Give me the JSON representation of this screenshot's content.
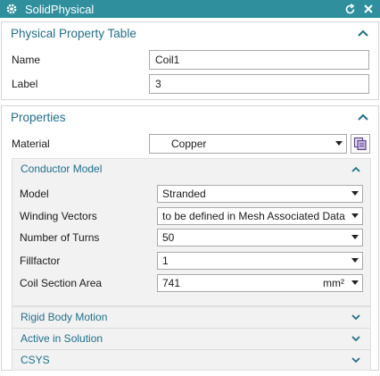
{
  "window": {
    "title": "SolidPhysical"
  },
  "physical_property_table": {
    "title": "Physical Property Table",
    "name_label": "Name",
    "name_value": "Coil1",
    "label_label": "Label",
    "label_value": "3"
  },
  "properties": {
    "title": "Properties",
    "material_label": "Material",
    "material_value": "Copper",
    "conductor_model": {
      "title": "Conductor Model",
      "model_label": "Model",
      "model_value": "Stranded",
      "winding_label": "Winding Vectors",
      "winding_value": "to be defined in Mesh Associated Data",
      "turns_label": "Number of Turns",
      "turns_value": "50",
      "fill_label": "Fillfactor",
      "fill_value": "1",
      "area_label": "Coil Section Area",
      "area_value": "741",
      "area_unit": "mm²"
    },
    "collapsed_sections": [
      "Rigid Body Motion",
      "Active in Solution",
      "CSYS"
    ]
  },
  "colors": {
    "titlebar": "#2f8f9d",
    "heading": "#1f6f8b",
    "panel_bg": "#f2f2f2"
  }
}
